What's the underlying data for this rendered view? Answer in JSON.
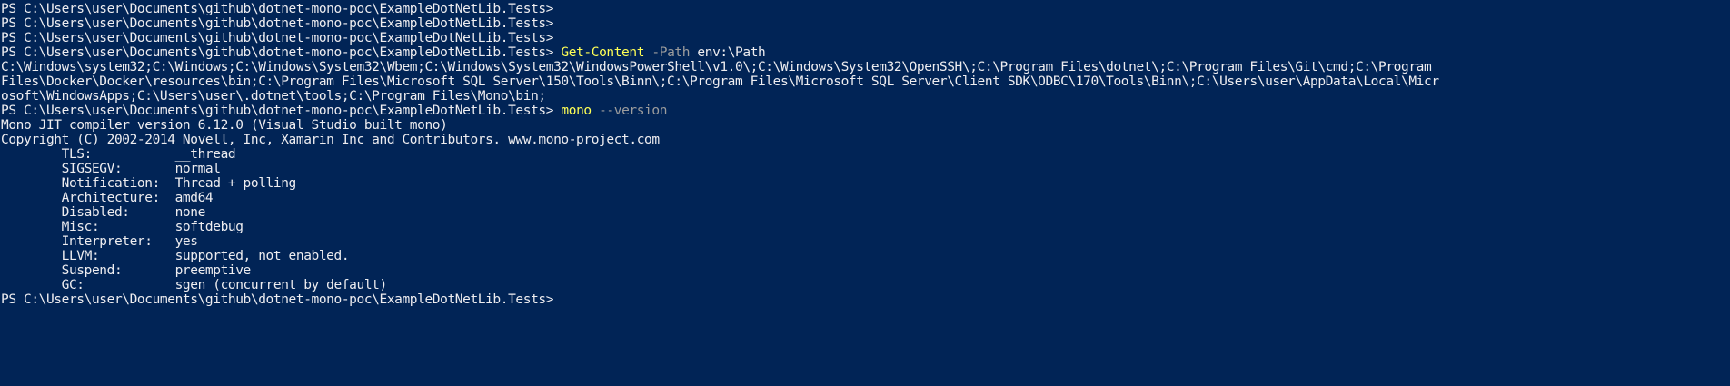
{
  "prompt": "PS C:\\Users\\user\\Documents\\github\\dotnet-mono-poc\\ExampleDotNetLib.Tests>",
  "command1": {
    "name": "Get-Content",
    "param": "-Path",
    "arg": "env:\\Path"
  },
  "path_output": [
    "C:\\Windows\\system32;C:\\Windows;C:\\Windows\\System32\\Wbem;C:\\Windows\\System32\\WindowsPowerShell\\v1.0\\;C:\\Windows\\System32\\OpenSSH\\;C:\\Program Files\\dotnet\\;C:\\Program Files\\Git\\cmd;C:\\Program",
    "Files\\Docker\\Docker\\resources\\bin;C:\\Program Files\\Microsoft SQL Server\\150\\Tools\\Binn\\;C:\\Program Files\\Microsoft SQL Server\\Client SDK\\ODBC\\170\\Tools\\Binn\\;C:\\Users\\user\\AppData\\Local\\Micr",
    "osoft\\WindowsApps;C:\\Users\\user\\.dotnet\\tools;C:\\Program Files\\Mono\\bin;"
  ],
  "command2": {
    "name": "mono",
    "param": "--version"
  },
  "mono_output": [
    "Mono JIT compiler version 6.12.0 (Visual Studio built mono)",
    "Copyright (C) 2002-2014 Novell, Inc, Xamarin Inc and Contributors. www.mono-project.com",
    "        TLS:           __thread",
    "        SIGSEGV:       normal",
    "        Notification:  Thread + polling",
    "        Architecture:  amd64",
    "        Disabled:      none",
    "        Misc:          softdebug",
    "        Interpreter:   yes",
    "        LLVM:          supported, not enabled.",
    "        Suspend:       preemptive",
    "        GC:            sgen (concurrent by default)"
  ],
  "colors": {
    "background": "#012456",
    "foreground": "#eeedf0",
    "command": "#ffff55",
    "parameter": "#9d9d9d"
  }
}
